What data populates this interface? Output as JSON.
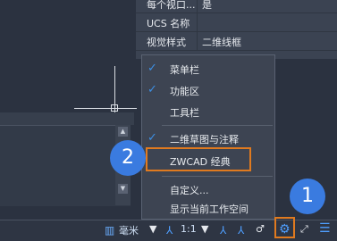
{
  "properties": {
    "rows": [
      {
        "key": "每个视口...",
        "value": "是"
      },
      {
        "key": "UCS 名称",
        "value": ""
      },
      {
        "key": "视觉样式",
        "value": "二维线框"
      }
    ]
  },
  "context_menu": {
    "items": [
      {
        "label": "菜单栏",
        "checked": true
      },
      {
        "label": "功能区",
        "checked": true
      },
      {
        "label": "工具栏",
        "checked": false
      },
      {
        "label": "二维草图与注释",
        "checked": true
      },
      {
        "label": "ZWCAD 经典",
        "checked": false,
        "highlighted": true
      },
      {
        "label": "自定义...",
        "checked": false
      },
      {
        "label": "显示当前工作空间",
        "checked": false
      }
    ],
    "check_mark": "✓"
  },
  "annotations": {
    "badge_1": "1",
    "badge_2": "2"
  },
  "status_bar": {
    "units_label": "毫米",
    "scale_label": "1:1",
    "icons": [
      "units-icon",
      "annotation-scale-icon",
      "annotation-visibility-icon",
      "auto-scale-icon",
      "isolate-objects-icon",
      "workspace-gear-icon",
      "fullscreen-icon",
      "menu-icon"
    ]
  },
  "colors": {
    "accent": "#3a7be0",
    "highlight_border": "#e07a1f",
    "check": "#3d8fe3"
  }
}
